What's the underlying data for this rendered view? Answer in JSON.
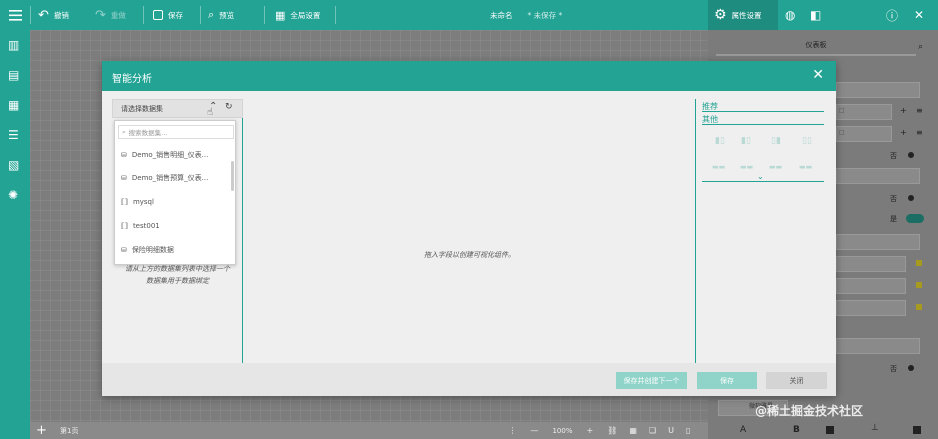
{
  "toolbar": {
    "undo": "撤销",
    "redo": "重做",
    "save": "保存",
    "preview": "预览",
    "global_settings": "全局设置",
    "doc_name": "未命名",
    "doc_status": "* 未保存 *",
    "property_settings": "属性设置"
  },
  "right_panel": {
    "tab_dashboard": "仪表板",
    "field_1": "□",
    "field_2": "□",
    "no_1": "否",
    "no_2": "否",
    "yes": "是",
    "no_3": "否",
    "style_label": "微软雅黑",
    "font_a": "A",
    "font_b": "B"
  },
  "bottom": {
    "page_tab": "第1页",
    "zoom": "100%",
    "minus": "—",
    "plus": "+"
  },
  "dialog": {
    "title": "智能分析",
    "close": "✕",
    "dataset_select": "请选择数据集",
    "search_placeholder": "搜索数据集...",
    "datasets": [
      {
        "label": "Demo_销售明细_仪表...",
        "icon": "database-icon"
      },
      {
        "label": "Demo_销售预算_仪表...",
        "icon": "database-icon"
      },
      {
        "label": "mysql",
        "icon": "connection-icon"
      },
      {
        "label": "test001",
        "icon": "connection-icon"
      },
      {
        "label": "保险明细数据",
        "icon": "database-icon"
      }
    ],
    "left_hint_1": "请从上方的数据集列表中选择一个",
    "left_hint_2": "数据集用于数据绑定",
    "mid_hint": "拖入字段以创建可视化组件。",
    "tab_recommend": "推荐",
    "tab_other": "其他",
    "btn_save_next": "保存并创建下一个",
    "btn_save": "保存",
    "btn_close": "关闭"
  },
  "watermark": "@稀土掘金技术社区",
  "colors": {
    "accent": "#22a394",
    "accent_light": "#8fd3c9"
  }
}
